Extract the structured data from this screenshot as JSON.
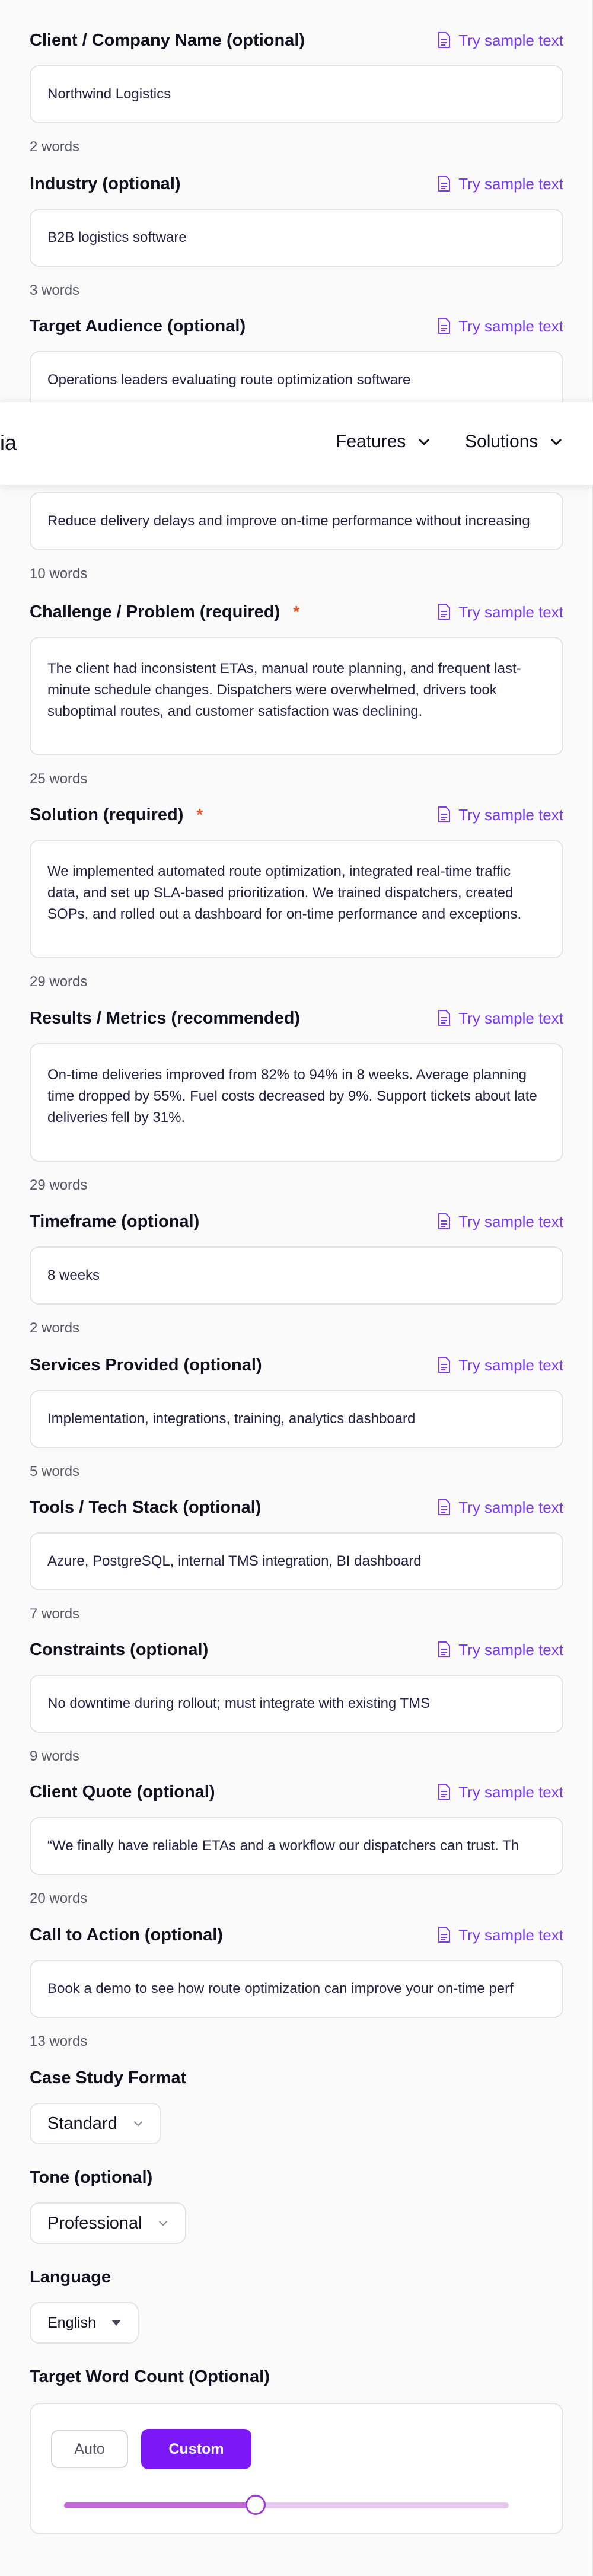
{
  "fields": [
    {
      "label": "Client / Company Name (optional)",
      "value": "Northwind Logistics",
      "words": "2 words",
      "required": false,
      "multiline": false
    },
    {
      "label": "Industry (optional)",
      "value": "B2B logistics software",
      "words": "3 words",
      "required": false,
      "multiline": false
    },
    {
      "label": "Target Audience (optional)",
      "value": "Operations leaders evaluating route optimization software",
      "words": "",
      "required": false,
      "multiline": false
    },
    {
      "label": "",
      "value": "Reduce delivery delays and improve on-time performance without increasing",
      "words": "10 words",
      "required": false,
      "multiline": false
    },
    {
      "label": "Challenge / Problem (required)",
      "value": "The client had inconsistent ETAs, manual route planning, and frequent last-minute schedule changes. Dispatchers were overwhelmed, drivers took suboptimal routes, and customer satisfaction was declining.",
      "words": "25 words",
      "required": true,
      "multiline": true
    },
    {
      "label": "Solution (required)",
      "value": "We implemented automated route optimization, integrated real-time traffic data, and set up SLA-based prioritization. We trained dispatchers, created SOPs, and rolled out a dashboard for on-time performance and exceptions.",
      "words": "29 words",
      "required": true,
      "multiline": true
    },
    {
      "label": "Results / Metrics (recommended)",
      "value": "On-time deliveries improved from 82% to 94% in 8 weeks. Average planning time dropped by 55%. Fuel costs decreased by 9%. Support tickets about late deliveries fell by 31%.",
      "words": "29 words",
      "required": false,
      "multiline": true
    },
    {
      "label": "Timeframe (optional)",
      "value": "8 weeks",
      "words": "2 words",
      "required": false,
      "multiline": false
    },
    {
      "label": "Services Provided (optional)",
      "value": "Implementation, integrations, training, analytics dashboard",
      "words": "5 words",
      "required": false,
      "multiline": false
    },
    {
      "label": "Tools / Tech Stack (optional)",
      "value": "Azure, PostgreSQL, internal TMS integration, BI dashboard",
      "words": "7 words",
      "required": false,
      "multiline": false
    },
    {
      "label": "Constraints (optional)",
      "value": "No downtime during rollout; must integrate with existing TMS",
      "words": "9 words",
      "required": false,
      "multiline": false
    },
    {
      "label": "Client Quote (optional)",
      "value": "“We finally have reliable ETAs and a workflow our dispatchers can trust. Th",
      "words": "20 words",
      "required": false,
      "multiline": false
    },
    {
      "label": "Call to Action (optional)",
      "value": "Book a demo to see how route optimization can improve your on-time perf",
      "words": "13 words",
      "required": false,
      "multiline": false
    }
  ],
  "sample_link_label": "Try sample text",
  "required_marker": "*",
  "navbar": {
    "logo_fragment": "ia",
    "items": [
      {
        "label": "Features"
      },
      {
        "label": "Solutions"
      }
    ]
  },
  "format": {
    "label": "Case Study Format",
    "value": "Standard"
  },
  "tone": {
    "label": "Tone (optional)",
    "value": "Professional"
  },
  "language": {
    "label": "Language",
    "value": "English"
  },
  "word_count": {
    "label": "Target Word Count (Optional)",
    "auto_label": "Auto",
    "custom_label": "Custom",
    "selected": "Custom",
    "slider_fraction": 0.43
  },
  "colors": {
    "accent": "#7c3aed",
    "button_primary": "#7c18f5",
    "required": "#e4572e",
    "slider_fill": "#c46ad6",
    "slider_track": "#e6c9ee"
  }
}
